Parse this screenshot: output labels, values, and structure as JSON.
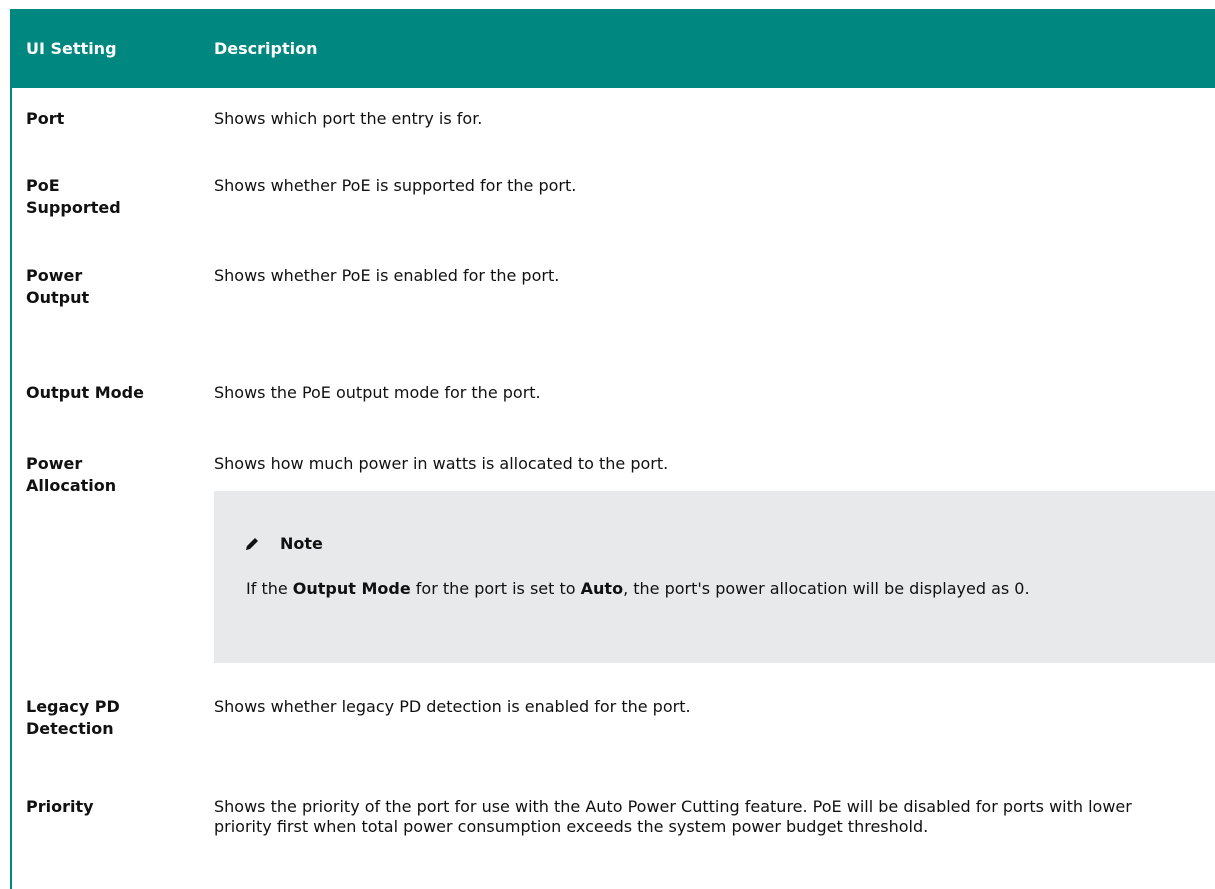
{
  "header": {
    "setting": "UI Setting",
    "description": "Description"
  },
  "rows": [
    {
      "setting": "Port",
      "description": "Shows which port the entry is for."
    },
    {
      "setting": "PoE Supported",
      "description": "Shows whether PoE is supported for the port."
    },
    {
      "setting": "Power Output",
      "description": "Shows whether PoE is enabled for the port."
    },
    {
      "setting": "Output Mode",
      "description": "Shows the PoE output mode for the port."
    },
    {
      "setting": "Power Allocation",
      "description": "Shows how much power in watts is allocated to the port."
    },
    {
      "setting": "Legacy PD Detection",
      "description": "Shows whether legacy PD detection is enabled for the port."
    },
    {
      "setting": "Priority",
      "description": "Shows the priority of the port for use with the Auto Power Cutting feature. PoE will be disabled for ports with lower priority first when total power consumption exceeds the system power budget threshold."
    }
  ],
  "note": {
    "icon": "pencil-icon",
    "title": "Note",
    "text_1": "If the ",
    "bold_1": "Output Mode",
    "text_2": " for the port is set to ",
    "bold_2": "Auto",
    "text_3": ", the port's power allocation will be displayed as 0."
  },
  "colors": {
    "header_bg": "#00877f",
    "note_bg": "#e8e9ea"
  }
}
